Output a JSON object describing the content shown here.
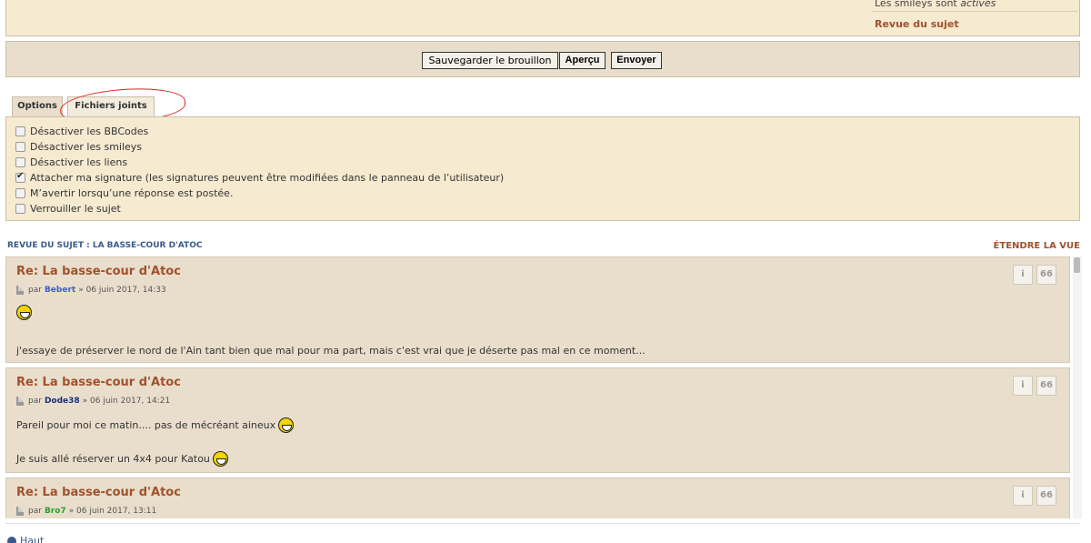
{
  "top_panel": {
    "smileys_prefix": "Les smileys sont ",
    "smileys_state": "activés",
    "review_link": "Revue du sujet"
  },
  "submit_bar": {
    "draft_label": "Sauvegarder le brouillon",
    "preview_label": "Aperçu",
    "send_label": "Envoyer"
  },
  "tabs": [
    {
      "label": "Options"
    },
    {
      "label": "Fichiers joints"
    }
  ],
  "options": [
    {
      "label": "Désactiver les BBCodes",
      "checked": false
    },
    {
      "label": "Désactiver les smileys",
      "checked": false
    },
    {
      "label": "Désactiver les liens",
      "checked": false
    },
    {
      "label": "Attacher ma signature (les signatures peuvent être modifiées dans le panneau de l’utilisateur)",
      "checked": true
    },
    {
      "label": "M’avertir lorsqu’une réponse est postée.",
      "checked": false
    },
    {
      "label": "Verrouiller le sujet",
      "checked": false
    }
  ],
  "review": {
    "title": "REVUE DU SUJET : LA BASSE-COUR D'ATOC",
    "expand": "ÉTENDRE LA VUE"
  },
  "posts": [
    {
      "title": "Re: La basse-cour d'Atoc",
      "by": "par",
      "author": "Bebert",
      "author_color": "#3b5bdb",
      "date": "» 06 juin 2017, 14:33",
      "line1": "",
      "line2": "j'essaye de préserver le nord de l'Ain tant bien que mal pour ma part, mais c'est vrai que je déserte pas mal en ce moment..."
    },
    {
      "title": "Re: La basse-cour d'Atoc",
      "by": "par",
      "author": "Dode38",
      "author_color": "#1a2f80",
      "date": "» 06 juin 2017, 14:21",
      "line1": "Pareil pour moi ce matin.... pas de mécréant aineux",
      "line2": "Je suis allé réserver un 4x4 pour Katou"
    },
    {
      "title": "Re: La basse-cour d'Atoc",
      "by": "par",
      "author": "Bro7",
      "author_color": "#2e9e2e",
      "date": "» 06 juin 2017, 13:11"
    }
  ],
  "post_buttons": {
    "info": "i",
    "quote": "66"
  },
  "footer": {
    "top_link": "Haut"
  }
}
